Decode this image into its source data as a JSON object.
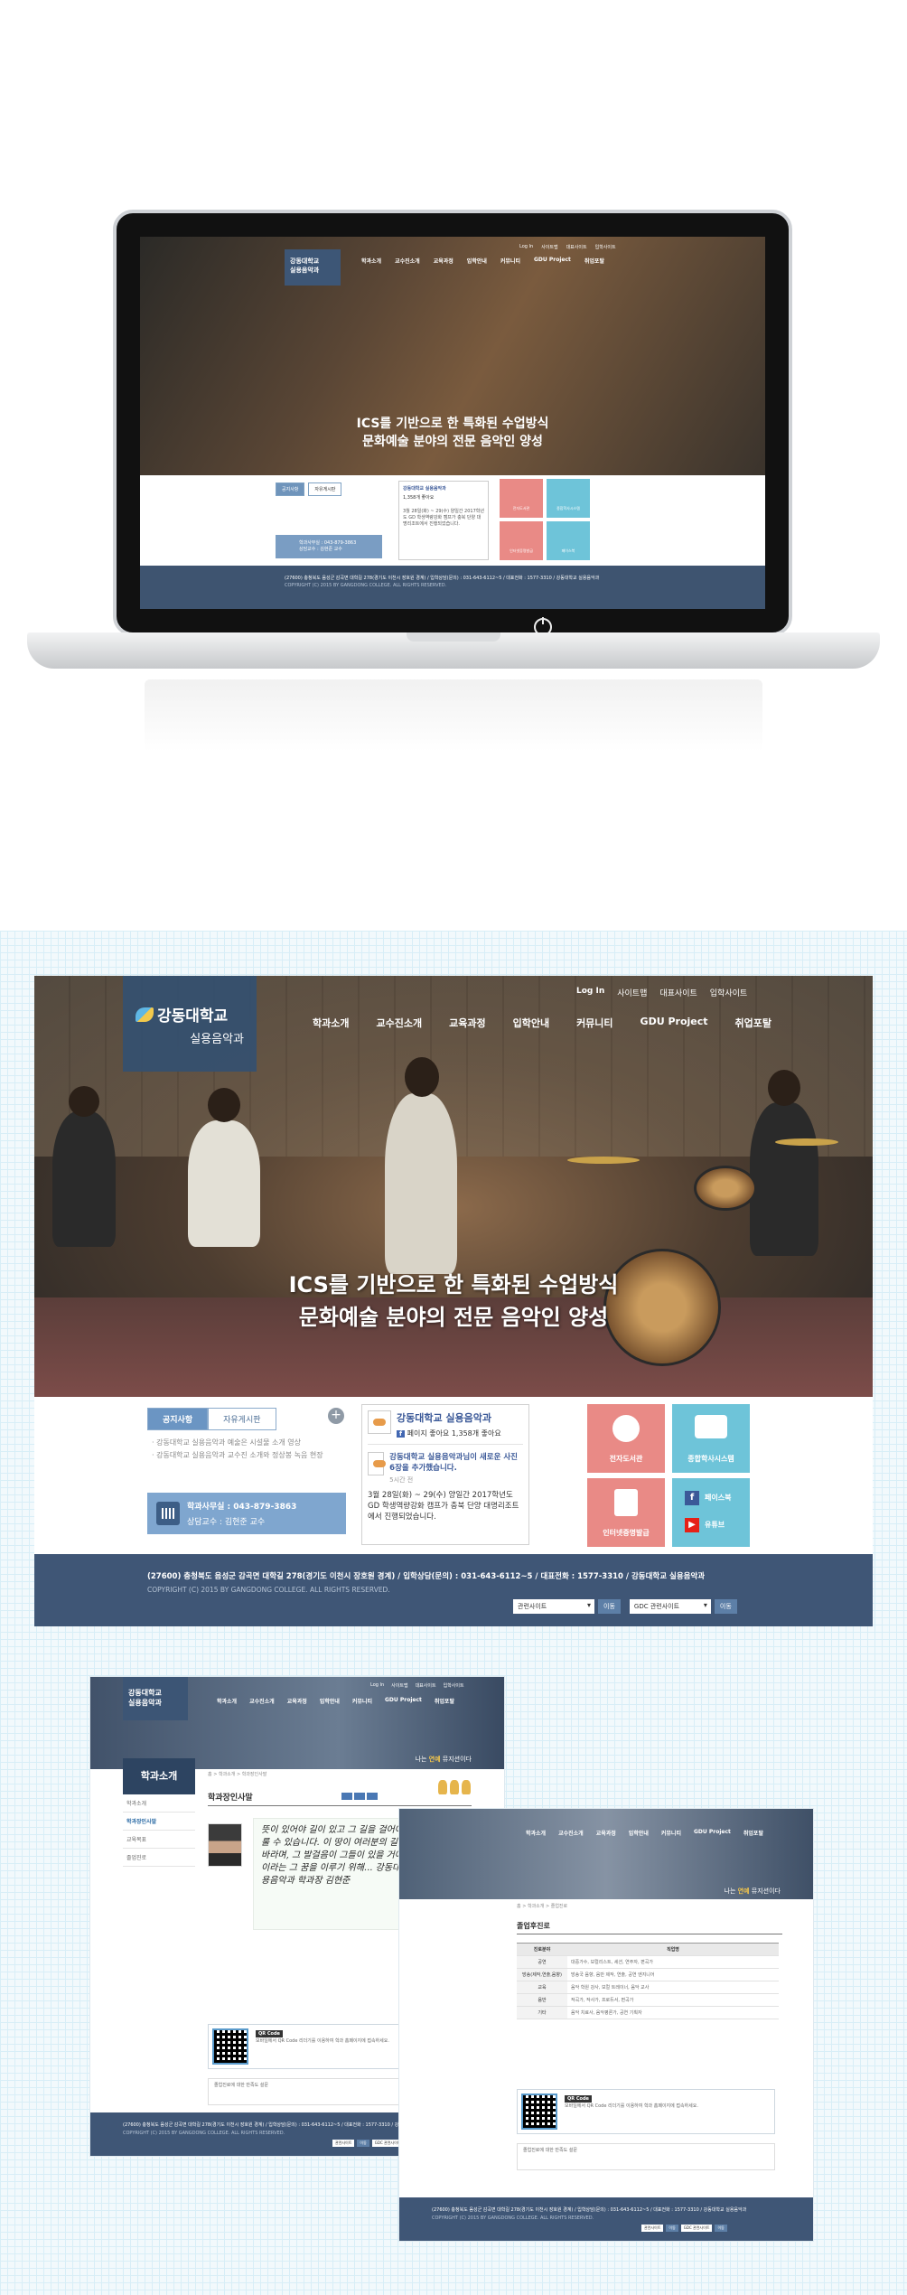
{
  "site": {
    "logo": {
      "main": "강동대학교",
      "sub": "실용음악과"
    },
    "util_nav": [
      "Log In",
      "사이트맵",
      "대표사이트",
      "입학사이트"
    ],
    "main_nav": [
      "학과소개",
      "교수진소개",
      "교육과정",
      "입학안내",
      "커뮤니티",
      "GDU Project",
      "취업포탈"
    ],
    "hero": {
      "line1": "ICS를 기반으로 한 특화된 수업방식",
      "line2": "문화예술 분야의 전문 음악인 양성"
    },
    "tabs": [
      "공지사항",
      "자유게시판"
    ],
    "plus": "+",
    "notices": [
      "강동대학교 실용음악과 예술은 시설물 소개 영상",
      "강동대학교 실용음악과 교수진 소개와 정상봉 녹음 현장"
    ],
    "contact": {
      "line1": "학과사무실 : 043-879-3863",
      "line2": "상담교수 : 김현준 교수"
    },
    "facebook": {
      "page_title": "강동대학교 실용음악과",
      "like_badge": "f",
      "like_text": "페이지 좋아요",
      "like_count": "1,358개 좋아요",
      "post_title": "강동대학교 실용음악과님이 새로운 사진 6장을 추가했습니다.",
      "post_time": "5시간 전",
      "post_text": "3월 28일(화) ~ 29(수) 양일간 2017학년도 GD 학생역량강화 캠프가 충북 단양 대명리조트에서 진행되었습니다."
    },
    "tiles": [
      "전자도서관",
      "종합학사시스템",
      "인터넷증명발급"
    ],
    "sns": {
      "facebook": "페이스북",
      "youtube": "유튜브"
    },
    "footer": {
      "address": "(27600) 충청북도 음성군 감곡면 대학길 278(경기도 이천시 장호원 경계) / 입학상담(문의) : 031-643-6112~5 / 대표전화 : 1577-3310 / 강동대학교 실용음악과",
      "copyright": "COPYRIGHT (C) 2015 BY GANGDONG COLLEGE. ALL RIGHTS RESERVED.",
      "select1": "관련사이트",
      "go1": "이동",
      "select2": "GDC 관련사이트",
      "go2": "이동"
    }
  },
  "sub1": {
    "lnb_title": "학과소개",
    "lnb_items": [
      "학과소개",
      "학과장인사말",
      "교육목표",
      "졸업진로"
    ],
    "crumb": "홈 > 학과소개 > 학과장인사말",
    "title": "학과장인사말",
    "tagline_prefix": "나는 ",
    "tagline_highlight": "연예",
    "tagline_suffix": " 뮤지션이다",
    "letter": "뜻이 있어야 길이 있고 그 길을 걸어야 꿈을 이룰 수 있습니다. 이 땅이 여러분의 길이 되길 바라며, 그 발걸음이 그들이 있을 거예요. 음악이라는 그 꿈을 이루기 위해... 강동대학교 실용음악과 학과장 김현준",
    "qr_badge": "QR Code",
    "qr_text": "모바일에서 QR Code 리더기를 이용하여 학과 홈페이지에 접속하세요.",
    "poll_title": "졸업진로에 대한 만족도 설문",
    "footer": "(27600) 충청북도 음성군 감곡면 대학길 278(경기도 이천시 장호원 경계) / 입학상담(문의) : 031-643-6112~5 / 대표전화 : 1577-3310 / 강동대학교 실용음악과",
    "copyright": "COPYRIGHT (C) 2015 BY GANGDONG COLLEGE. ALL RIGHTS RESERVED."
  },
  "sub2": {
    "crumb": "홈 > 학과소개 > 졸업진로",
    "title": "졸업후진로",
    "table_head": [
      "진로분야",
      "직업명"
    ],
    "rows": [
      [
        "공연",
        "대중가수, 보컬리스트, 세션, 연주자, 편곡가"
      ],
      [
        "방송(제작,연출,음향)",
        "방송국 음향, 음반 제작, 연출, 공연 엔지니어"
      ],
      [
        "교육",
        "음악 학원 강사, 보컬 트레이너, 음악 교사"
      ],
      [
        "음반",
        "작곡가, 작사가, 프로듀서, 편곡가"
      ],
      [
        "기타",
        "음악 치료사, 음악평론가, 공연 기획자"
      ]
    ]
  }
}
